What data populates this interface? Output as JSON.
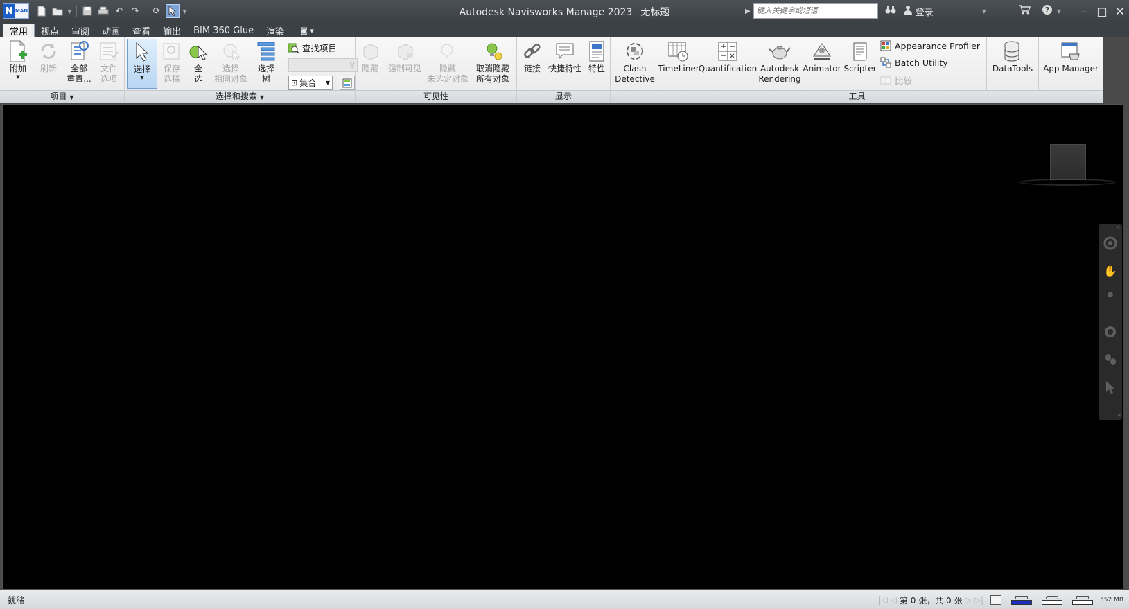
{
  "app": {
    "logo_letter": "N",
    "logo_sub": "MAN",
    "title": "Autodesk Navisworks Manage 2023",
    "document": "无标题"
  },
  "search": {
    "placeholder": "键入关键字或短语"
  },
  "account": {
    "login_label": "登录"
  },
  "tabs": [
    "常用",
    "视点",
    "审阅",
    "动画",
    "查看",
    "输出",
    "BIM 360 Glue",
    "渲染"
  ],
  "active_tab": "常用",
  "ribbon": {
    "project": {
      "label": "项目",
      "append": "附加",
      "refresh": "刷新",
      "reset_all_1": "全部",
      "reset_all_2": "重置...",
      "file_options_1": "文件",
      "file_options_2": "选项"
    },
    "select_search": {
      "label": "选择和搜索",
      "select": "选择",
      "save_sel_1": "保存",
      "save_sel_2": "选择",
      "select_all_1": "全",
      "select_all_2": "选",
      "select_same_1": "选择",
      "select_same_2": "相同对象",
      "selection_tree_1": "选择",
      "selection_tree_2": "树",
      "find_items": "查找项目",
      "sets_value": "集合"
    },
    "visibility": {
      "label": "可见性",
      "hide": "隐藏",
      "require": "强制可见",
      "hide_unselected_1": "隐藏",
      "hide_unselected_2": "未选定对象",
      "unhide_all_1": "取消隐藏",
      "unhide_all_2": "所有对象"
    },
    "display": {
      "label": "显示",
      "links": "链接",
      "quick_props": "快捷特性",
      "properties": "特性"
    },
    "tools": {
      "label": "工具",
      "clash_1": "Clash",
      "clash_2": "Detective",
      "timeliner": "TimeLiner",
      "quantification": "Quantification",
      "rendering_1": "Autodesk",
      "rendering_2": "Rendering",
      "animator": "Animator",
      "scripter": "Scripter",
      "appearance_profiler": "Appearance Profiler",
      "batch_utility": "Batch Utility",
      "compare": "比较",
      "datatools": "DataTools",
      "app_manager": "App Manager"
    }
  },
  "status": {
    "text": "就绪",
    "page_info": "第 0 张，共 0 张",
    "memory": "552 MB"
  }
}
